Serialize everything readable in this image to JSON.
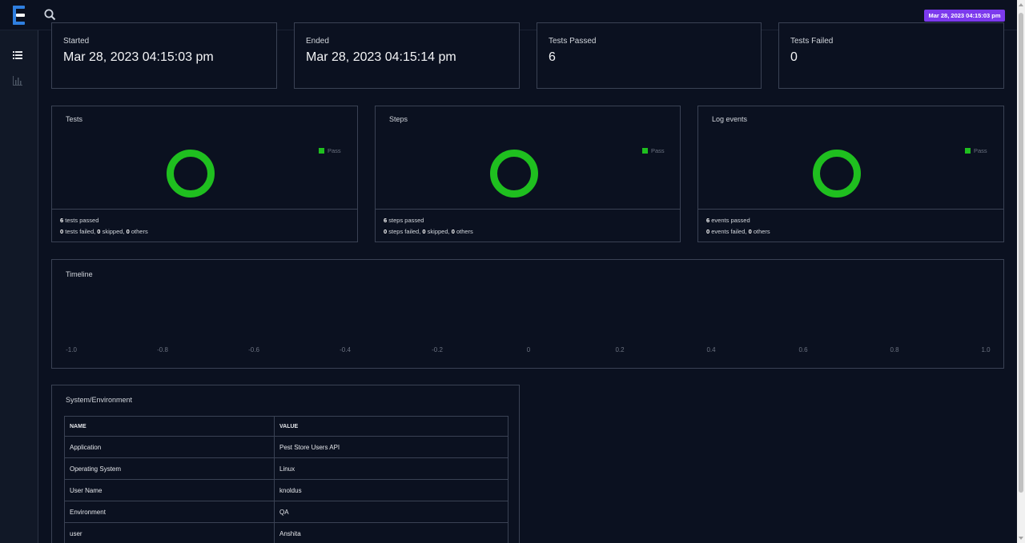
{
  "header": {
    "date_badge": "Mar 28, 2023 04:15:03 pm"
  },
  "stats": [
    {
      "label": "Started",
      "value": "Mar 28, 2023 04:15:03 pm"
    },
    {
      "label": "Ended",
      "value": "Mar 28, 2023 04:15:14 pm"
    },
    {
      "label": "Tests Passed",
      "value": "6"
    },
    {
      "label": "Tests Failed",
      "value": "0"
    }
  ],
  "donut_cards": [
    {
      "title": "Tests",
      "legend": "Pass",
      "passed_count": "6",
      "passed_text": "tests passed",
      "failed_count": "0",
      "failed_text": "tests failed,",
      "skipped_count": "0",
      "skipped_text": "skipped,",
      "others_count": "0",
      "others_text": "others"
    },
    {
      "title": "Steps",
      "legend": "Pass",
      "passed_count": "6",
      "passed_text": "steps passed",
      "failed_count": "0",
      "failed_text": "steps failed,",
      "skipped_count": "0",
      "skipped_text": "skipped,",
      "others_count": "0",
      "others_text": "others"
    },
    {
      "title": "Log events",
      "legend": "Pass",
      "passed_count": "6",
      "passed_text": "events passed",
      "failed_count": "0",
      "failed_text": "events failed,",
      "others_count": "0",
      "others_text": "others"
    }
  ],
  "timeline": {
    "title": "Timeline",
    "ticks": [
      "-1.0",
      "-0.8",
      "-0.6",
      "-0.4",
      "-0.2",
      "0",
      "0.2",
      "0.4",
      "0.6",
      "0.8",
      "1.0"
    ]
  },
  "environment": {
    "title": "System/Environment",
    "columns": [
      "NAME",
      "VALUE"
    ],
    "rows": [
      [
        "Application",
        "Pest Store Users API"
      ],
      [
        "Operating System",
        "Linux"
      ],
      [
        "User Name",
        "knoldus"
      ],
      [
        "Environment",
        "QA"
      ],
      [
        "user",
        "Anshita"
      ]
    ]
  },
  "colors": {
    "pass": "#1fbf1f",
    "badge": "#7c3aed",
    "background": "#0b1120"
  },
  "icons": {
    "logo": "extent-logo-icon",
    "search": "search-icon",
    "dashboard": "list-icon",
    "analytics": "bar-chart-icon"
  }
}
